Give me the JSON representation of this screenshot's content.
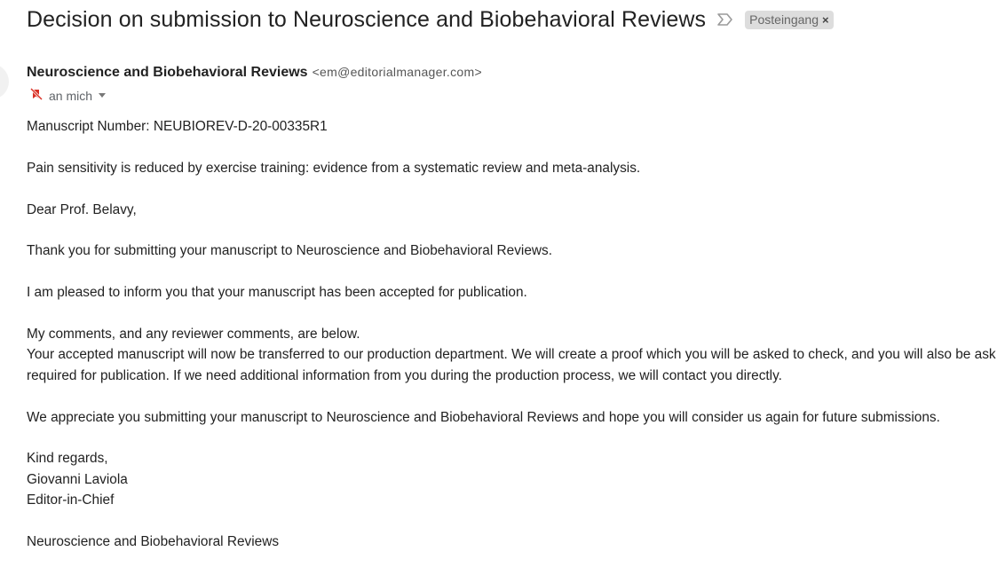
{
  "email": {
    "subject": "Decision on submission to Neuroscience and Biobehavioral Reviews",
    "label": "Posteingang",
    "label_close": "×",
    "sender": {
      "name": "Neuroscience and Biobehavioral Reviews",
      "email": "<em@editorialmanager.com>"
    },
    "to": "an mich",
    "body": {
      "manuscript_number": "Manuscript Number: NEUBIOREV-D-20-00335R1",
      "paper_title": "Pain sensitivity is reduced by exercise training: evidence from a systematic review and meta-analysis.",
      "salutation": "Dear Prof. Belavy,",
      "thanks": "Thank you for submitting your manuscript to Neuroscience and Biobehavioral Reviews.",
      "acceptance": "I am pleased to inform you that your manuscript has been accepted for publication.",
      "comments_intro": "My comments, and any reviewer comments, are below.",
      "production_line1": "Your accepted manuscript will now be transferred to our production department. We will create a proof which you will be asked to check, and you will also be ask",
      "production_line2": "required for publication. If we need additional information from you during the production process, we will contact you directly.",
      "appreciation": "We appreciate you submitting your manuscript to Neuroscience and Biobehavioral Reviews and hope you will consider us again for future submissions.",
      "closing": "Kind regards,",
      "editor_name": "Giovanni Laviola",
      "editor_role": "Editor-in-Chief",
      "journal": "Neuroscience and Biobehavioral Reviews"
    }
  },
  "colors": {
    "label_bg": "#dddddd",
    "importance_red": "#d93025",
    "text": "#222222"
  },
  "icons": {
    "importance": "importance-marker-icon",
    "no_forward": "no-forward-icon",
    "caret": "chevron-down-icon"
  }
}
